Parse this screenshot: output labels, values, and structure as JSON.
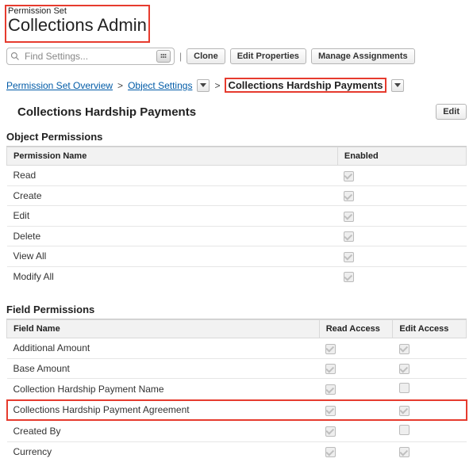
{
  "header": {
    "subtitle": "Permission Set",
    "title": "Collections Admin"
  },
  "toolbar": {
    "search_placeholder": "Find Settings...",
    "clone": "Clone",
    "edit_props": "Edit Properties",
    "manage": "Manage Assignments"
  },
  "breadcrumb": {
    "overview": "Permission Set Overview",
    "object_settings": "Object Settings",
    "current": "Collections Hardship Payments"
  },
  "section": {
    "title": "Collections Hardship Payments",
    "edit_btn": "Edit"
  },
  "object_permissions": {
    "title": "Object Permissions",
    "col_name": "Permission Name",
    "col_enabled": "Enabled",
    "rows": [
      {
        "name": "Read",
        "enabled": true
      },
      {
        "name": "Create",
        "enabled": true
      },
      {
        "name": "Edit",
        "enabled": true
      },
      {
        "name": "Delete",
        "enabled": true
      },
      {
        "name": "View All",
        "enabled": true
      },
      {
        "name": "Modify All",
        "enabled": true
      }
    ]
  },
  "field_permissions": {
    "title": "Field Permissions",
    "col_name": "Field Name",
    "col_read": "Read Access",
    "col_edit": "Edit Access",
    "rows": [
      {
        "name": "Additional Amount",
        "read": true,
        "edit": true,
        "highlight": false
      },
      {
        "name": "Base Amount",
        "read": true,
        "edit": true,
        "highlight": false
      },
      {
        "name": "Collection Hardship Payment Name",
        "read": true,
        "edit": false,
        "highlight": false
      },
      {
        "name": "Collections Hardship Payment Agreement",
        "read": true,
        "edit": true,
        "highlight": true
      },
      {
        "name": "Created By",
        "read": true,
        "edit": false,
        "highlight": false
      },
      {
        "name": "Currency",
        "read": true,
        "edit": true,
        "highlight": false
      }
    ]
  }
}
